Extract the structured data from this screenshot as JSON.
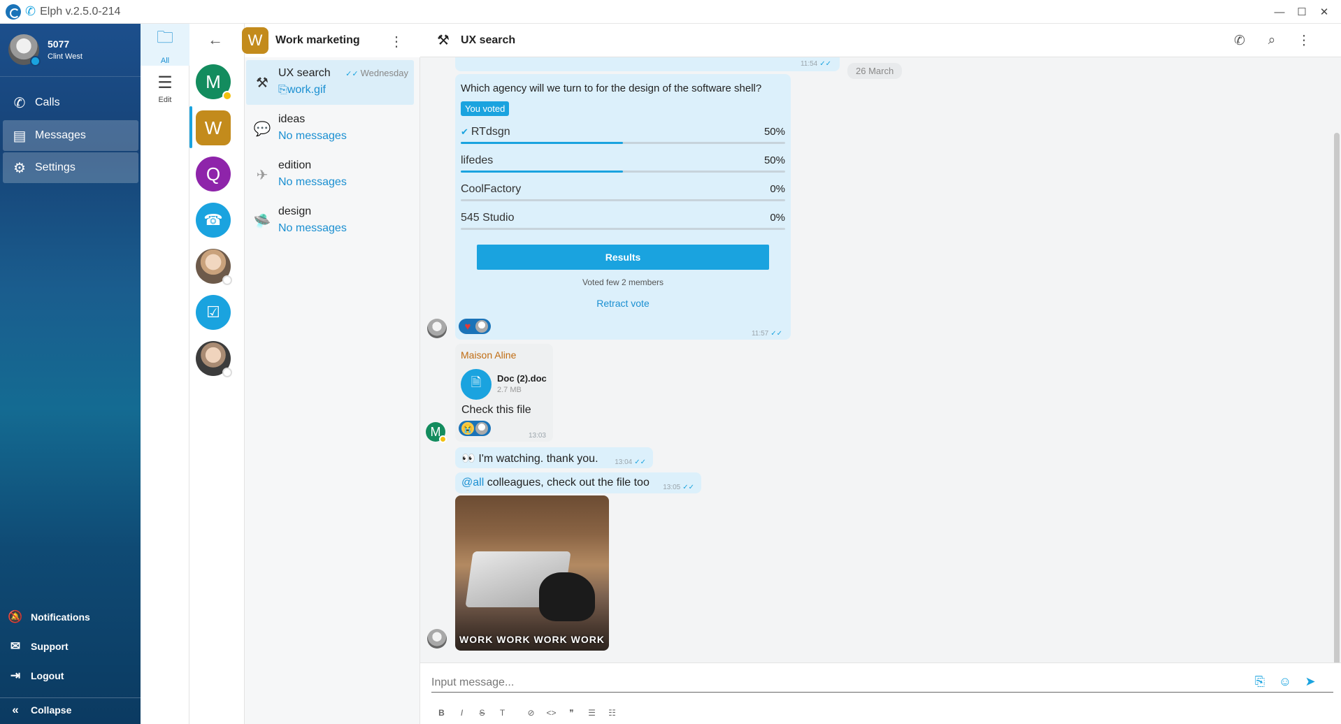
{
  "window": {
    "title": "Elph v.2.5.0-214"
  },
  "profile": {
    "number": "5077",
    "name": "Clint West"
  },
  "nav": [
    {
      "label": "Calls"
    },
    {
      "label": "Messages"
    },
    {
      "label": "Settings"
    }
  ],
  "bottom_nav": {
    "notifications": "Notifications",
    "support": "Support",
    "logout": "Logout",
    "collapse": "Collapse"
  },
  "folders": [
    {
      "label": "All"
    },
    {
      "label": "Edit"
    }
  ],
  "groups": [
    {
      "letter": "M",
      "color": "#138c5e"
    },
    {
      "letter": "W",
      "color": "#c38b1c"
    },
    {
      "letter": "Q",
      "color": "#8e24aa"
    }
  ],
  "chatlist": {
    "group_title": "Work marketing",
    "group_letter": "W",
    "items": [
      {
        "title": "UX search",
        "sub": "work.gif",
        "date": "Wednesday"
      },
      {
        "title": "ideas",
        "sub": "No messages"
      },
      {
        "title": "edition",
        "sub": "No messages"
      },
      {
        "title": "design",
        "sub": "No messages"
      }
    ]
  },
  "chat": {
    "title": "UX search",
    "date_chip": "26 March",
    "prev_time": "11:54",
    "poll": {
      "question": "Which agency will we turn to for the design of the software shell?",
      "badge": "You voted",
      "options": [
        {
          "label": "RTdsgn",
          "percent": "50%",
          "value": 50,
          "checked": true
        },
        {
          "label": "lifedes",
          "percent": "50%",
          "value": 50
        },
        {
          "label": "CoolFactory",
          "percent": "0%",
          "value": 0
        },
        {
          "label": "545 Studio",
          "percent": "0%",
          "value": 0
        }
      ],
      "results_label": "Results",
      "voted_text": "Voted few 2 members",
      "retract_label": "Retract vote",
      "time": "11:57"
    },
    "file_message": {
      "sender": "Maison Aline",
      "file_name": "Doc (2).doc",
      "file_size": "2.7 MB",
      "text": "Check this file",
      "time": "13:03"
    },
    "message1": {
      "text": "I'm watching. thank you.",
      "time": "13:04"
    },
    "message2": {
      "mention": "@all",
      "text": " colleagues, check out the file too",
      "time": "13:05"
    },
    "gif_caption": "WORK WORK WORK WORK"
  },
  "composer": {
    "placeholder": "Input message...",
    "format_buttons": [
      "B",
      "I",
      "S",
      "T",
      "⊘",
      "<>",
      "❞",
      "☰",
      "☷"
    ]
  },
  "colors": {
    "accent": "#1aa3df",
    "bubble": "#dcf0fb",
    "sidebar": "#164377"
  }
}
